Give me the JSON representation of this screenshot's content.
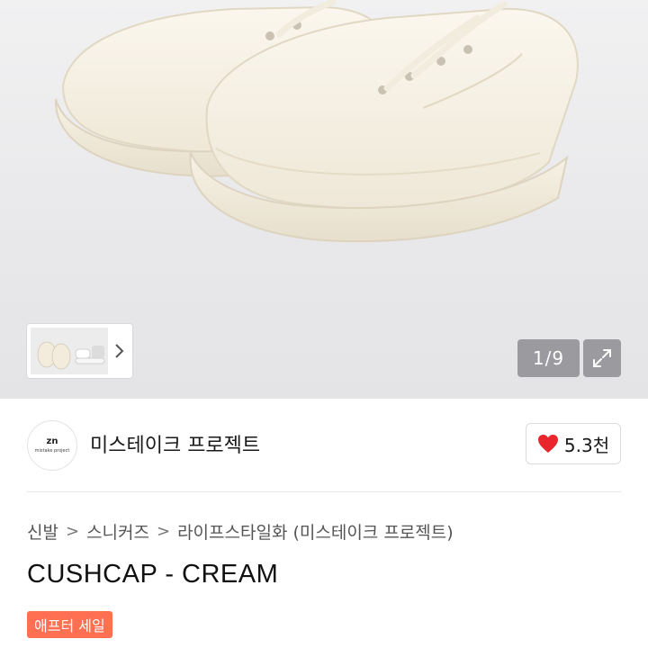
{
  "gallery": {
    "counter": "1/9",
    "icons": {
      "next": "chevron-right-icon",
      "fullscreen": "expand-icon"
    }
  },
  "seller": {
    "logo_mark": "zn",
    "logo_sub": "mistake project",
    "name": "미스테이크 프로젝트",
    "likes": "5.3천",
    "like_icon": "heart-icon",
    "like_color": "#e8262b"
  },
  "breadcrumb": [
    "신발",
    "스니커즈",
    "라이프스타일화 (미스테이크 프로젝트)"
  ],
  "product": {
    "title": "CUSHCAP - CREAM",
    "badge": "애프터 세일",
    "badge_color": "#ff7052"
  }
}
